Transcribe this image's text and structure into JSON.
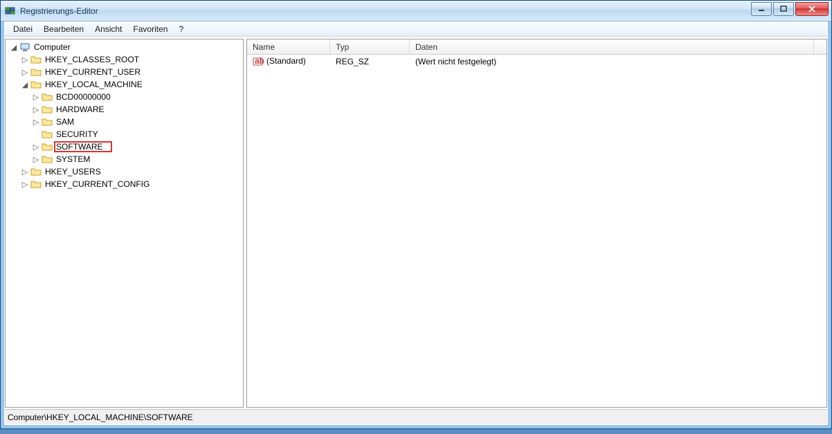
{
  "window": {
    "title": "Registrierungs-Editor"
  },
  "menu": {
    "datei": "Datei",
    "bearbeiten": "Bearbeiten",
    "ansicht": "Ansicht",
    "favoriten": "Favoriten",
    "help": "?"
  },
  "tree": {
    "root": "Computer",
    "hkcr": "HKEY_CLASSES_ROOT",
    "hkcu": "HKEY_CURRENT_USER",
    "hklm": "HKEY_LOCAL_MACHINE",
    "bcd": "BCD00000000",
    "hardware": "HARDWARE",
    "sam": "SAM",
    "security": "SECURITY",
    "software": "SOFTWARE",
    "system": "SYSTEM",
    "hku": "HKEY_USERS",
    "hkcc": "HKEY_CURRENT_CONFIG"
  },
  "list": {
    "col_name": "Name",
    "col_typ": "Typ",
    "col_daten": "Daten",
    "row0_name": "(Standard)",
    "row0_typ": "REG_SZ",
    "row0_daten": "(Wert nicht festgelegt)"
  },
  "status": {
    "path": "Computer\\HKEY_LOCAL_MACHINE\\SOFTWARE"
  }
}
